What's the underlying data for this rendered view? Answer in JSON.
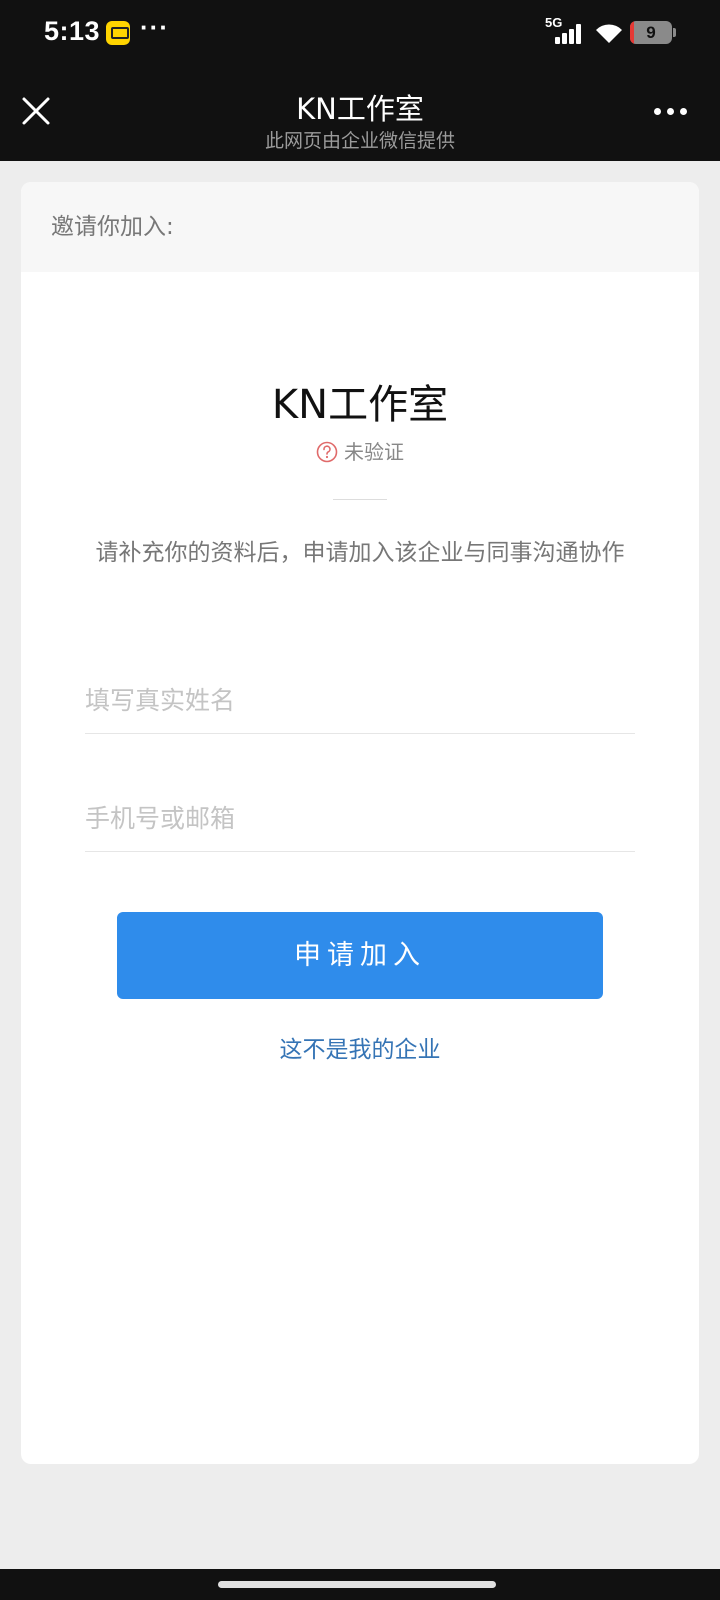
{
  "status_bar": {
    "time": "5:13",
    "more": "···",
    "network": "5G",
    "battery_level": "9",
    "battery_fraction": 0.09,
    "battery_color": "#e53935"
  },
  "nav": {
    "title": "KN工作室",
    "subtitle": "此网页由企业微信提供",
    "close_icon": "close-icon",
    "more_icon": "more-dots-icon"
  },
  "card": {
    "header": "邀请你加入:",
    "company_name": "KN工作室",
    "verify_status": "未验证",
    "verify_icon": "question-circle-icon",
    "description": "请补充你的资料后，申请加入该企业与同事沟通协作",
    "name_field": {
      "placeholder": "填写真实姓名",
      "value": ""
    },
    "contact_field": {
      "placeholder": "手机号或邮箱",
      "value": ""
    },
    "apply_button": "申请加入",
    "not_mine_link": "这不是我的企业"
  },
  "colors": {
    "accent": "#2f8ceb",
    "link": "#3574b5",
    "warning": "#e06a6a",
    "nav_bg": "#111111"
  }
}
